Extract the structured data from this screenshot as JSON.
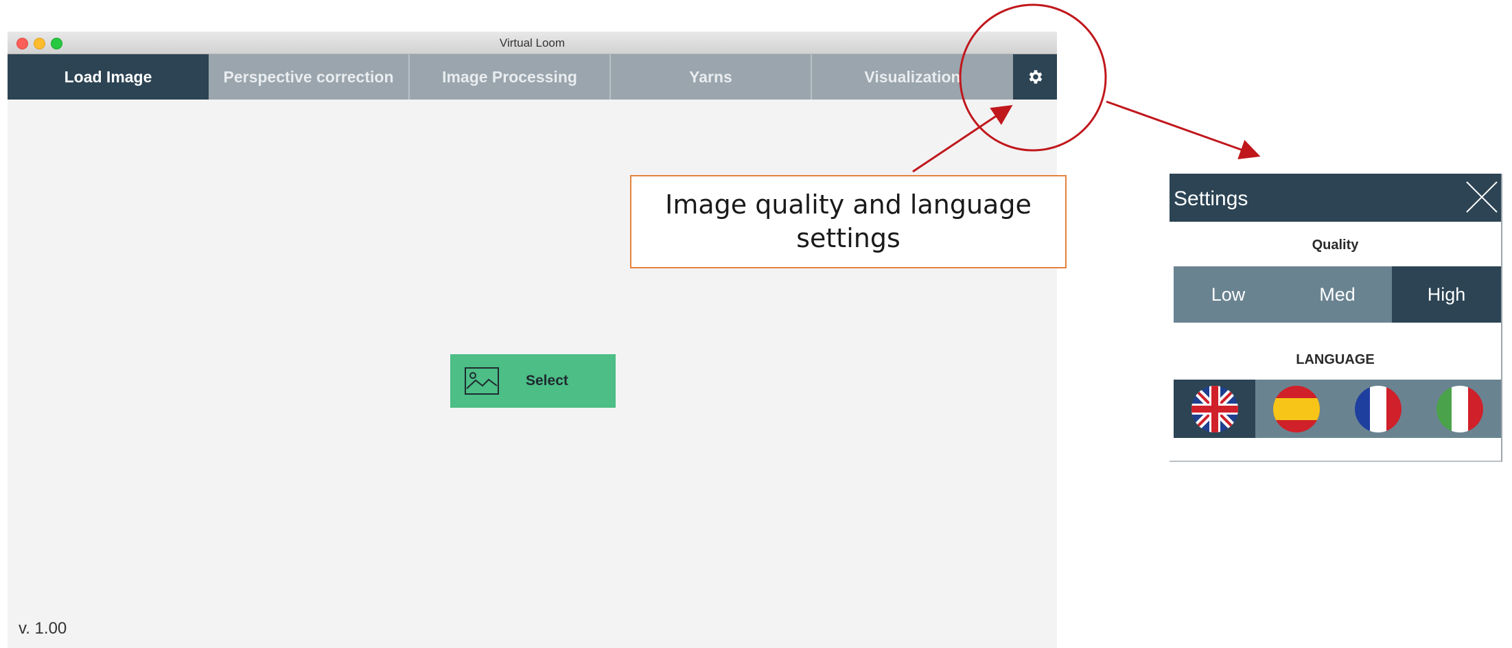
{
  "window": {
    "title": "Virtual Loom",
    "tabs": [
      {
        "label": "Load Image",
        "active": true
      },
      {
        "label": "Perspective correction",
        "active": false
      },
      {
        "label": "Image Processing",
        "active": false
      },
      {
        "label": "Yarns",
        "active": false
      },
      {
        "label": "Visualization",
        "active": false
      }
    ],
    "settings_icon": "gear-icon",
    "select_button": {
      "label": "Select",
      "icon": "image-icon"
    },
    "version": "v. 1.00"
  },
  "annotation": {
    "callout_text": "Image quality and language settings"
  },
  "settings_panel": {
    "title": "Settings",
    "close_icon": "close-icon",
    "quality_label": "Quality",
    "quality_options": [
      "Low",
      "Med",
      "High"
    ],
    "quality_selected": "High",
    "language_label": "LANGUAGE",
    "languages": [
      {
        "icon": "uk-flag-icon",
        "selected": true
      },
      {
        "icon": "spain-flag-icon",
        "selected": false
      },
      {
        "icon": "france-flag-icon",
        "selected": false
      },
      {
        "icon": "italy-flag-icon",
        "selected": false
      }
    ]
  },
  "colors": {
    "header_dark": "#2c4454",
    "tab_inactive": "#9aa5ad",
    "select_green": "#4cbe86",
    "annotation_red": "#c0171c",
    "callout_border": "#e4823d"
  }
}
